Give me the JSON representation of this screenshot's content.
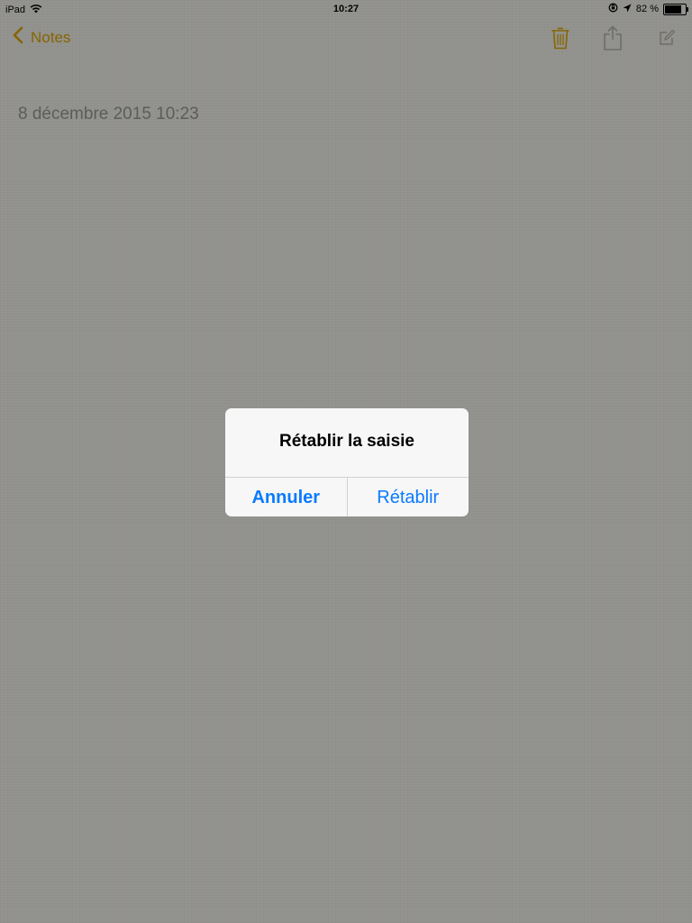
{
  "status_bar": {
    "device": "iPad",
    "time": "10:27",
    "battery_percent_text": "82 %",
    "battery_level": 0.82,
    "icons": [
      "wifi-icon",
      "rotation-lock-icon",
      "location-icon",
      "battery-icon"
    ]
  },
  "nav_bar": {
    "back_label": "Notes",
    "accent_color": "#e0a800",
    "icons": [
      "chevron-left-icon",
      "trash-icon",
      "share-icon",
      "compose-icon"
    ]
  },
  "note": {
    "date": "8 décembre 2015 10:23"
  },
  "alert": {
    "title": "Rétablir la saisie",
    "cancel_label": "Annuler",
    "confirm_label": "Rétablir",
    "button_color": "#0a7aff"
  }
}
